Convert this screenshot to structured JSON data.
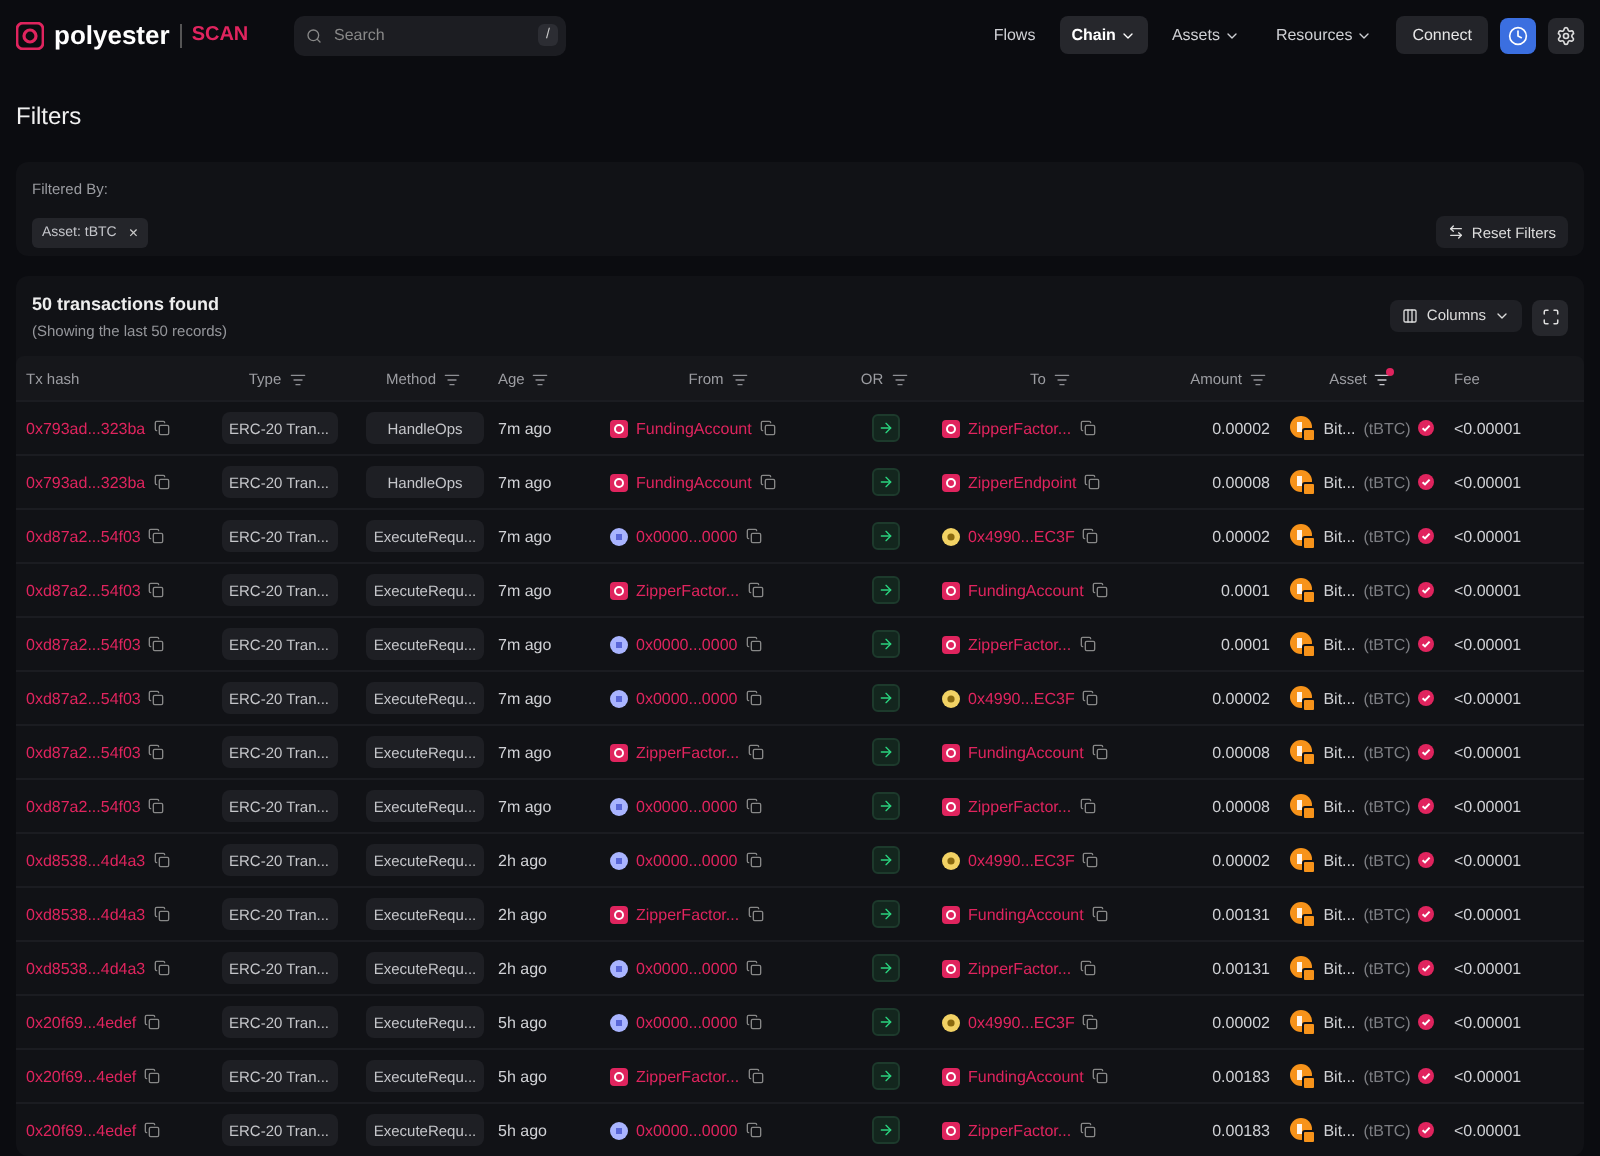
{
  "brand": {
    "name": "polyester",
    "product": "SCAN"
  },
  "search": {
    "placeholder": "Search",
    "shortcut": "/"
  },
  "nav": [
    {
      "label": "Flows",
      "selected": false,
      "dropdown": false
    },
    {
      "label": "Chain",
      "selected": true,
      "dropdown": true
    },
    {
      "label": "Assets",
      "selected": false,
      "dropdown": true
    },
    {
      "label": "Resources",
      "selected": false,
      "dropdown": true
    }
  ],
  "connect_button": "Connect",
  "page_title": "Filters",
  "filters": {
    "label": "Filtered By:",
    "chips": [
      {
        "label": "Asset: tBTC",
        "remove": "×"
      }
    ],
    "reset_button": "Reset Filters"
  },
  "results": {
    "title": "50 transactions found",
    "subtitle": "(Showing the last 50 records)",
    "columns_button": "Columns"
  },
  "table": {
    "columns": [
      {
        "label": "Tx hash",
        "filter": false
      },
      {
        "label": "Type",
        "filter": true,
        "filter_active": false
      },
      {
        "label": "Method",
        "filter": true,
        "filter_active": false
      },
      {
        "label": "Age",
        "filter": true,
        "filter_active": false
      },
      {
        "label": "From",
        "filter": true,
        "filter_active": false
      },
      {
        "label": "OR",
        "filter": true,
        "filter_active": false
      },
      {
        "label": "To",
        "filter": true,
        "filter_active": false
      },
      {
        "label": "Amount",
        "filter": true,
        "filter_active": false
      },
      {
        "label": "Asset",
        "filter": true,
        "filter_active": true
      },
      {
        "label": "Fee",
        "filter": false
      }
    ],
    "rows": [
      {
        "hash": "0x793ad...323ba",
        "type": "ERC-20 Tran...",
        "method": "HandleOps",
        "age": "7m ago",
        "from": {
          "name": "FundingAccount",
          "kind": "contract"
        },
        "to": {
          "name": "ZipperFactor...",
          "kind": "contract"
        },
        "amount": "0.00002",
        "asset": "Bit...",
        "symbol": "(tBTC)",
        "fee": "<0.00001"
      },
      {
        "hash": "0x793ad...323ba",
        "type": "ERC-20 Tran...",
        "method": "HandleOps",
        "age": "7m ago",
        "from": {
          "name": "FundingAccount",
          "kind": "contract"
        },
        "to": {
          "name": "ZipperEndpoint",
          "kind": "contract"
        },
        "amount": "0.00008",
        "asset": "Bit...",
        "symbol": "(tBTC)",
        "fee": "<0.00001"
      },
      {
        "hash": "0xd87a2...54f03",
        "type": "ERC-20 Tran...",
        "method": "ExecuteRequ...",
        "age": "7m ago",
        "from": {
          "name": "0x0000...0000",
          "kind": "eoa"
        },
        "to": {
          "name": "0x4990...EC3F",
          "kind": "wallet"
        },
        "amount": "0.00002",
        "asset": "Bit...",
        "symbol": "(tBTC)",
        "fee": "<0.00001"
      },
      {
        "hash": "0xd87a2...54f03",
        "type": "ERC-20 Tran...",
        "method": "ExecuteRequ...",
        "age": "7m ago",
        "from": {
          "name": "ZipperFactor...",
          "kind": "contract"
        },
        "to": {
          "name": "FundingAccount",
          "kind": "contract"
        },
        "amount": "0.0001",
        "asset": "Bit...",
        "symbol": "(tBTC)",
        "fee": "<0.00001"
      },
      {
        "hash": "0xd87a2...54f03",
        "type": "ERC-20 Tran...",
        "method": "ExecuteRequ...",
        "age": "7m ago",
        "from": {
          "name": "0x0000...0000",
          "kind": "eoa"
        },
        "to": {
          "name": "ZipperFactor...",
          "kind": "contract"
        },
        "amount": "0.0001",
        "asset": "Bit...",
        "symbol": "(tBTC)",
        "fee": "<0.00001"
      },
      {
        "hash": "0xd87a2...54f03",
        "type": "ERC-20 Tran...",
        "method": "ExecuteRequ...",
        "age": "7m ago",
        "from": {
          "name": "0x0000...0000",
          "kind": "eoa"
        },
        "to": {
          "name": "0x4990...EC3F",
          "kind": "wallet"
        },
        "amount": "0.00002",
        "asset": "Bit...",
        "symbol": "(tBTC)",
        "fee": "<0.00001"
      },
      {
        "hash": "0xd87a2...54f03",
        "type": "ERC-20 Tran...",
        "method": "ExecuteRequ...",
        "age": "7m ago",
        "from": {
          "name": "ZipperFactor...",
          "kind": "contract"
        },
        "to": {
          "name": "FundingAccount",
          "kind": "contract"
        },
        "amount": "0.00008",
        "asset": "Bit...",
        "symbol": "(tBTC)",
        "fee": "<0.00001"
      },
      {
        "hash": "0xd87a2...54f03",
        "type": "ERC-20 Tran...",
        "method": "ExecuteRequ...",
        "age": "7m ago",
        "from": {
          "name": "0x0000...0000",
          "kind": "eoa"
        },
        "to": {
          "name": "ZipperFactor...",
          "kind": "contract"
        },
        "amount": "0.00008",
        "asset": "Bit...",
        "symbol": "(tBTC)",
        "fee": "<0.00001"
      },
      {
        "hash": "0xd8538...4d4a3",
        "type": "ERC-20 Tran...",
        "method": "ExecuteRequ...",
        "age": "2h ago",
        "from": {
          "name": "0x0000...0000",
          "kind": "eoa"
        },
        "to": {
          "name": "0x4990...EC3F",
          "kind": "wallet"
        },
        "amount": "0.00002",
        "asset": "Bit...",
        "symbol": "(tBTC)",
        "fee": "<0.00001"
      },
      {
        "hash": "0xd8538...4d4a3",
        "type": "ERC-20 Tran...",
        "method": "ExecuteRequ...",
        "age": "2h ago",
        "from": {
          "name": "ZipperFactor...",
          "kind": "contract"
        },
        "to": {
          "name": "FundingAccount",
          "kind": "contract"
        },
        "amount": "0.00131",
        "asset": "Bit...",
        "symbol": "(tBTC)",
        "fee": "<0.00001"
      },
      {
        "hash": "0xd8538...4d4a3",
        "type": "ERC-20 Tran...",
        "method": "ExecuteRequ...",
        "age": "2h ago",
        "from": {
          "name": "0x0000...0000",
          "kind": "eoa"
        },
        "to": {
          "name": "ZipperFactor...",
          "kind": "contract"
        },
        "amount": "0.00131",
        "asset": "Bit...",
        "symbol": "(tBTC)",
        "fee": "<0.00001"
      },
      {
        "hash": "0x20f69...4edef",
        "type": "ERC-20 Tran...",
        "method": "ExecuteRequ...",
        "age": "5h ago",
        "from": {
          "name": "0x0000...0000",
          "kind": "eoa"
        },
        "to": {
          "name": "0x4990...EC3F",
          "kind": "wallet"
        },
        "amount": "0.00002",
        "asset": "Bit...",
        "symbol": "(tBTC)",
        "fee": "<0.00001"
      },
      {
        "hash": "0x20f69...4edef",
        "type": "ERC-20 Tran...",
        "method": "ExecuteRequ...",
        "age": "5h ago",
        "from": {
          "name": "ZipperFactor...",
          "kind": "contract"
        },
        "to": {
          "name": "FundingAccount",
          "kind": "contract"
        },
        "amount": "0.00183",
        "asset": "Bit...",
        "symbol": "(tBTC)",
        "fee": "<0.00001"
      },
      {
        "hash": "0x20f69...4edef",
        "type": "ERC-20 Tran...",
        "method": "ExecuteRequ...",
        "age": "5h ago",
        "from": {
          "name": "0x0000...0000",
          "kind": "eoa"
        },
        "to": {
          "name": "ZipperFactor...",
          "kind": "contract"
        },
        "amount": "0.00183",
        "asset": "Bit...",
        "symbol": "(tBTC)",
        "fee": "<0.00001"
      }
    ]
  }
}
